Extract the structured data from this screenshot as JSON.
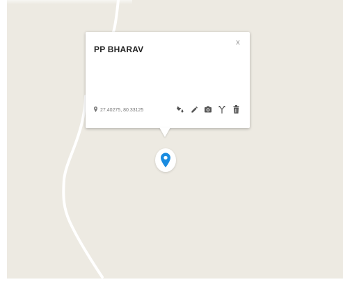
{
  "popup": {
    "title": "PP BHARAV",
    "close_label": "x",
    "coordinates": "27.40275, 80.33125",
    "actions": [
      {
        "icon": "paint-bucket-icon",
        "name": "fill-color"
      },
      {
        "icon": "pencil-icon",
        "name": "edit"
      },
      {
        "icon": "camera-icon",
        "name": "add-photo"
      },
      {
        "icon": "route-fork-icon",
        "name": "directions"
      },
      {
        "icon": "trash-icon",
        "name": "delete"
      }
    ]
  },
  "marker": {
    "icon": "location-pin-icon",
    "color": "#1a8ce0"
  },
  "map": {
    "background": "#edeae2",
    "road_color": "#ffffff"
  }
}
